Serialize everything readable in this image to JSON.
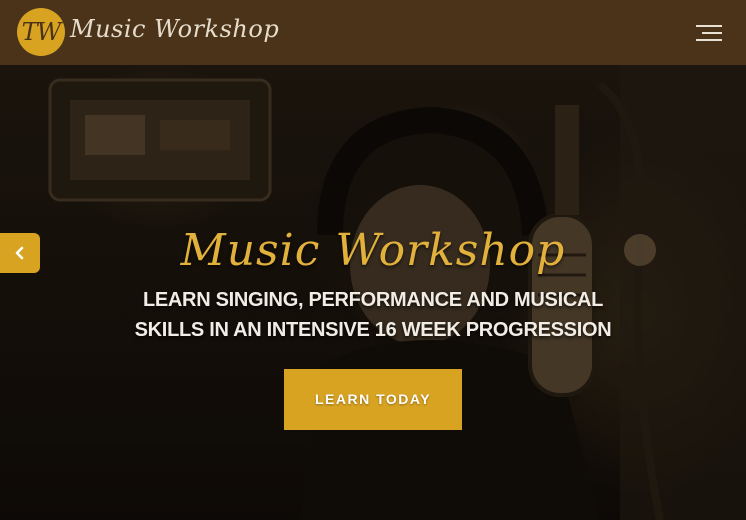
{
  "header": {
    "logo_badge": "TW",
    "logo_text": "Music Workshop",
    "menu_icon": "hamburger-menu-icon"
  },
  "hero": {
    "title": "Music Workshop",
    "subtitle_line1": "LEARN SINGING, PERFORMANCE AND MUSICAL",
    "subtitle_line2": "SKILLS IN AN INTENSIVE 16 WEEK PROGRESSION",
    "cta_label": "LEARN TODAY",
    "prev_icon": "chevron-left-icon"
  },
  "colors": {
    "header_bg": "#4a3318",
    "accent": "#d9a322",
    "title_gold": "#e2b13b",
    "text_light": "#f1ece4"
  }
}
